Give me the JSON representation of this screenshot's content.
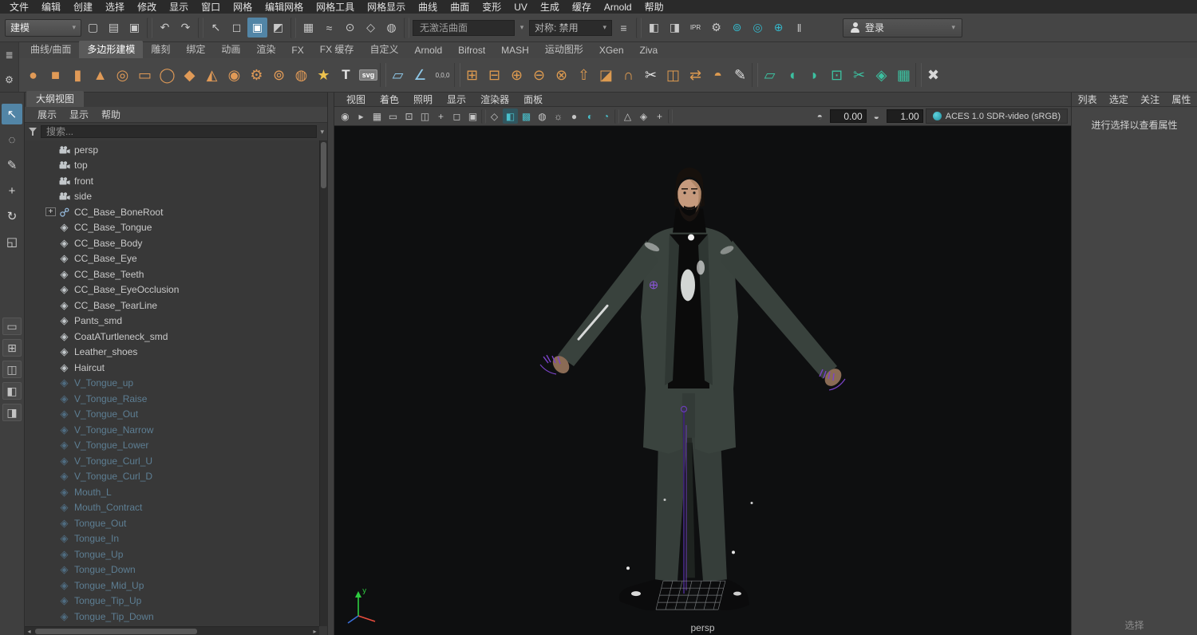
{
  "menubar": {
    "items": [
      "文件",
      "编辑",
      "创建",
      "选择",
      "修改",
      "显示",
      "窗口",
      "网格",
      "编辑网格",
      "网格工具",
      "网格显示",
      "曲线",
      "曲面",
      "变形",
      "UV",
      "生成",
      "缓存",
      "Arnold",
      "帮助"
    ]
  },
  "statusline": {
    "mode": "建模",
    "icons_left": [
      {
        "name": "new-scene-icon",
        "glyph": "▢"
      },
      {
        "name": "open-scene-icon",
        "glyph": "▤"
      },
      {
        "name": "save-scene-icon",
        "glyph": "▣"
      },
      {
        "name": "separator",
        "glyph": "",
        "variant": "sep"
      },
      {
        "name": "undo-icon",
        "glyph": "↶"
      },
      {
        "name": "redo-icon",
        "glyph": "↷"
      },
      {
        "name": "separator",
        "glyph": "",
        "variant": "sep"
      },
      {
        "name": "select-tool-icon",
        "glyph": "↖"
      },
      {
        "name": "select-hierarchy-icon",
        "glyph": "◻"
      },
      {
        "name": "select-object-mode-icon",
        "glyph": "▣",
        "variant": "active"
      },
      {
        "name": "select-component-mode-icon",
        "glyph": "◩"
      },
      {
        "name": "separator",
        "glyph": "",
        "variant": "sep"
      },
      {
        "name": "snap-to-grid-icon",
        "glyph": "▦"
      },
      {
        "name": "snap-to-curve-icon",
        "glyph": "≈"
      },
      {
        "name": "snap-to-point-icon",
        "glyph": "⊙"
      },
      {
        "name": "snap-to-plane-icon",
        "glyph": "◇"
      },
      {
        "name": "make-live-icon",
        "glyph": "◍"
      },
      {
        "name": "separator",
        "glyph": "",
        "variant": "sep"
      }
    ],
    "surface_field": "无激活曲面",
    "symmetry_field": "对称: 禁用",
    "icons_right": [
      {
        "name": "construction-history-icon",
        "glyph": "≡"
      },
      {
        "name": "separator",
        "glyph": "",
        "variant": "sep"
      },
      {
        "name": "render-frame-icon",
        "glyph": "◧"
      },
      {
        "name": "ipr-render-icon",
        "glyph": "◨"
      },
      {
        "name": "ipr-label-icon",
        "glyph": "IPR",
        "variant": "text"
      },
      {
        "name": "render-settings-icon",
        "glyph": "⚙"
      },
      {
        "name": "render-view-icon",
        "glyph": "⊚",
        "tint": "#35b5c8"
      },
      {
        "name": "light-editor-icon",
        "glyph": "◎",
        "tint": "#35b5c8"
      },
      {
        "name": "toggle-viewport-icon",
        "glyph": "⊕",
        "tint": "#35b5c8"
      },
      {
        "name": "pause-icon",
        "glyph": "‖"
      }
    ],
    "login_label": "登录"
  },
  "shelf": {
    "menu_icons": [
      {
        "name": "shelf-tab-list-icon",
        "glyph": "≣"
      },
      {
        "name": "shelf-gear-icon",
        "glyph": "⚙"
      }
    ],
    "tabs": [
      {
        "label": "曲线/曲面"
      },
      {
        "label": "多边形建模",
        "variant": "active"
      },
      {
        "label": "雕刻"
      },
      {
        "label": "绑定"
      },
      {
        "label": "动画"
      },
      {
        "label": "渲染"
      },
      {
        "label": "FX"
      },
      {
        "label": "FX 缓存"
      },
      {
        "label": "自定义"
      },
      {
        "label": "Arnold"
      },
      {
        "label": "Bifrost"
      },
      {
        "label": "MASH"
      },
      {
        "label": "运动图形"
      },
      {
        "label": "XGen"
      },
      {
        "label": "Ziva"
      }
    ],
    "icons": [
      {
        "name": "poly-sphere-icon",
        "glyph": "●",
        "tint": "#e09a57"
      },
      {
        "name": "poly-cube-icon",
        "glyph": "■",
        "tint": "#e09a57"
      },
      {
        "name": "poly-cylinder-icon",
        "glyph": "▮",
        "tint": "#e09a57"
      },
      {
        "name": "poly-cone-icon",
        "glyph": "▲",
        "tint": "#e09a57"
      },
      {
        "name": "poly-torus-icon",
        "glyph": "◎",
        "tint": "#e09a57"
      },
      {
        "name": "poly-plane-icon",
        "glyph": "▭",
        "tint": "#e09a57"
      },
      {
        "name": "poly-disc-icon",
        "glyph": "◯",
        "tint": "#e09a57"
      },
      {
        "name": "poly-platonic-icon",
        "glyph": "◆",
        "tint": "#e09a57"
      },
      {
        "name": "poly-pyramid-icon",
        "glyph": "◭",
        "tint": "#e09a57"
      },
      {
        "name": "poly-pipe-icon",
        "glyph": "◉",
        "tint": "#e09a57"
      },
      {
        "name": "poly-gear-icon",
        "glyph": "⚙",
        "tint": "#e09a57"
      },
      {
        "name": "poly-soccerball-icon",
        "glyph": "⊚",
        "tint": "#e09a57"
      },
      {
        "name": "poly-superellipse-icon",
        "glyph": "◍",
        "tint": "#e09a57"
      },
      {
        "name": "poly-star-icon",
        "glyph": "★",
        "tint": "#edc24e"
      },
      {
        "name": "poly-text-icon",
        "glyph": "T",
        "tint": "#e8e8e8",
        "variant": "boldtext"
      },
      {
        "name": "svg-tool-icon",
        "glyph": "svg",
        "variant": "badge"
      },
      {
        "name": "separator",
        "glyph": "",
        "variant": "sep"
      },
      {
        "name": "construction-plane-icon",
        "glyph": "▱",
        "tint": "#8fc8e8"
      },
      {
        "name": "angle-snap-icon",
        "glyph": "∠",
        "tint": "#8fc8e8"
      },
      {
        "name": "coordinates-icon",
        "glyph": "0,0,0",
        "tint": "#cfcfcf",
        "variant": "tinytext"
      },
      {
        "name": "separator",
        "glyph": "",
        "variant": "sep"
      },
      {
        "name": "combine-icon",
        "glyph": "⊞",
        "tint": "#dc9a50"
      },
      {
        "name": "separate-icon",
        "glyph": "⊟",
        "tint": "#dc9a50"
      },
      {
        "name": "boolean-union-icon",
        "glyph": "⊕",
        "tint": "#dc9a50"
      },
      {
        "name": "boolean-difference-icon",
        "glyph": "⊖",
        "tint": "#dc9a50"
      },
      {
        "name": "boolean-intersection-icon",
        "glyph": "⊗",
        "tint": "#dc9a50"
      },
      {
        "name": "extrude-icon",
        "glyph": "⇧",
        "tint": "#dc9a50"
      },
      {
        "name": "bevel-icon",
        "glyph": "◪",
        "tint": "#dc9a50"
      },
      {
        "name": "bridge-icon",
        "glyph": "∩",
        "tint": "#dc9a50"
      },
      {
        "name": "multi-cut-icon",
        "glyph": "✂",
        "tint": "#e0e0e0"
      },
      {
        "name": "insert-edge-loop-icon",
        "glyph": "◫",
        "tint": "#dc9a50"
      },
      {
        "name": "mirror-icon",
        "glyph": "⇄",
        "tint": "#dc9a50"
      },
      {
        "name": "smooth-icon",
        "glyph": "◓",
        "tint": "#dc9a50"
      },
      {
        "name": "quad-draw-icon",
        "glyph": "✎",
        "tint": "#e0e0e0"
      },
      {
        "name": "separator",
        "glyph": "",
        "variant": "sep"
      },
      {
        "name": "planar-uv-icon",
        "glyph": "▱",
        "tint": "#3cc0a0"
      },
      {
        "name": "cylindrical-uv-icon",
        "glyph": "◖",
        "tint": "#3cc0a0"
      },
      {
        "name": "spherical-uv-icon",
        "glyph": "◗",
        "tint": "#3cc0a0"
      },
      {
        "name": "automatic-uv-icon",
        "glyph": "⊡",
        "tint": "#3cc0a0"
      },
      {
        "name": "cut-uv-icon",
        "glyph": "✂",
        "tint": "#3cc0a0"
      },
      {
        "name": "unfold-uv-icon",
        "glyph": "◈",
        "tint": "#3cc0a0"
      },
      {
        "name": "layout-uv-icon",
        "glyph": "▦",
        "tint": "#3cc0a0"
      },
      {
        "name": "separator",
        "glyph": "",
        "variant": "sep"
      },
      {
        "name": "delete-component-icon",
        "glyph": "✖",
        "tint": "#d8d8d8"
      }
    ]
  },
  "toolbox": {
    "tools": [
      {
        "name": "select-tool-icon",
        "glyph": "↖",
        "variant": "active"
      },
      {
        "name": "lasso-tool-icon",
        "glyph": "◌"
      },
      {
        "name": "paint-select-tool-icon",
        "glyph": "✎"
      },
      {
        "name": "move-tool-icon",
        "glyph": "+"
      },
      {
        "name": "rotate-tool-icon",
        "glyph": "↻"
      },
      {
        "name": "scale-tool-icon",
        "glyph": "◱"
      }
    ],
    "layouts": [
      {
        "name": "layout-single-pane-icon",
        "glyph": "▭"
      },
      {
        "name": "layout-four-pane-icon",
        "glyph": "⊞"
      },
      {
        "name": "layout-two-pane-icon",
        "glyph": "◫"
      },
      {
        "name": "layout-outliner-pane-icon",
        "glyph": "◧"
      },
      {
        "name": "layout-split-pane-icon",
        "glyph": "◨"
      }
    ]
  },
  "outliner": {
    "title": "大纲视图",
    "menus": [
      "展示",
      "显示",
      "帮助"
    ],
    "search_placeholder": "搜索...",
    "items": [
      {
        "label": "persp",
        "type": "camera"
      },
      {
        "label": "top",
        "type": "camera"
      },
      {
        "label": "front",
        "type": "camera"
      },
      {
        "label": "side",
        "type": "camera"
      },
      {
        "label": "CC_Base_BoneRoot",
        "type": "joint",
        "expander": "+"
      },
      {
        "label": "CC_Base_Tongue",
        "type": "mesh"
      },
      {
        "label": "CC_Base_Body",
        "type": "mesh"
      },
      {
        "label": "CC_Base_Eye",
        "type": "mesh"
      },
      {
        "label": "CC_Base_Teeth",
        "type": "mesh"
      },
      {
        "label": "CC_Base_EyeOcclusion",
        "type": "mesh"
      },
      {
        "label": "CC_Base_TearLine",
        "type": "mesh"
      },
      {
        "label": "Pants_smd",
        "type": "mesh"
      },
      {
        "label": "CoatATurtleneck_smd",
        "type": "mesh"
      },
      {
        "label": "Leather_shoes",
        "type": "mesh"
      },
      {
        "label": "Haircut",
        "type": "mesh"
      },
      {
        "label": "V_Tongue_up",
        "type": "mesh",
        "variant": "dim"
      },
      {
        "label": "V_Tongue_Raise",
        "type": "mesh",
        "variant": "dim"
      },
      {
        "label": "V_Tongue_Out",
        "type": "mesh",
        "variant": "dim"
      },
      {
        "label": "V_Tongue_Narrow",
        "type": "mesh",
        "variant": "dim"
      },
      {
        "label": "V_Tongue_Lower",
        "type": "mesh",
        "variant": "dim"
      },
      {
        "label": "V_Tongue_Curl_U",
        "type": "mesh",
        "variant": "dim"
      },
      {
        "label": "V_Tongue_Curl_D",
        "type": "mesh",
        "variant": "dim"
      },
      {
        "label": "Mouth_L",
        "type": "mesh",
        "variant": "dim"
      },
      {
        "label": "Mouth_Contract",
        "type": "mesh",
        "variant": "dim"
      },
      {
        "label": "Tongue_Out",
        "type": "mesh",
        "variant": "dim"
      },
      {
        "label": "Tongue_In",
        "type": "mesh",
        "variant": "dim"
      },
      {
        "label": "Tongue_Up",
        "type": "mesh",
        "variant": "dim"
      },
      {
        "label": "Tongue_Down",
        "type": "mesh",
        "variant": "dim"
      },
      {
        "label": "Tongue_Mid_Up",
        "type": "mesh",
        "variant": "dim"
      },
      {
        "label": "Tongue_Tip_Up",
        "type": "mesh",
        "variant": "dim"
      },
      {
        "label": "Tongue_Tip_Down",
        "type": "mesh",
        "variant": "dim"
      }
    ]
  },
  "viewport": {
    "menus": [
      "视图",
      "着色",
      "照明",
      "显示",
      "渲染器",
      "面板"
    ],
    "toolbar_icons": [
      {
        "name": "camera-attributes-icon",
        "glyph": "◉"
      },
      {
        "name": "bookmark-icon",
        "glyph": "▸"
      },
      {
        "name": "grid-toggle-icon",
        "glyph": "▦"
      },
      {
        "name": "film-gate-icon",
        "glyph": "▭"
      },
      {
        "name": "resolution-gate-icon",
        "glyph": "⊡"
      },
      {
        "name": "gate-mask-icon",
        "glyph": "◫"
      },
      {
        "name": "field-chart-icon",
        "glyph": "+"
      },
      {
        "name": "safe-action-icon",
        "glyph": "◻"
      },
      {
        "name": "safe-title-icon",
        "glyph": "▣"
      },
      {
        "name": "separator",
        "glyph": "",
        "variant": "sep"
      },
      {
        "name": "wireframe-icon",
        "glyph": "◇"
      },
      {
        "name": "shaded-mode-icon",
        "glyph": "◧",
        "tint": "#49c0cc",
        "variant": "active"
      },
      {
        "name": "textured-mode-icon",
        "glyph": "▩",
        "tint": "#49c0cc"
      },
      {
        "name": "default-material-icon",
        "glyph": "◍"
      },
      {
        "name": "lighting-icon",
        "glyph": "☼"
      },
      {
        "name": "shadows-icon",
        "glyph": "●"
      },
      {
        "name": "ambient-occlusion-icon",
        "glyph": "◐",
        "tint": "#49c0cc"
      },
      {
        "name": "anti-aliasing-icon",
        "glyph": "◔",
        "tint": "#49c0cc"
      },
      {
        "name": "separator",
        "glyph": "",
        "variant": "sep"
      },
      {
        "name": "isolate-select-icon",
        "glyph": "△"
      },
      {
        "name": "xray-icon",
        "glyph": "◈"
      },
      {
        "name": "joint-xray-icon",
        "glyph": "+"
      },
      {
        "name": "separator",
        "glyph": "",
        "variant": "sep"
      }
    ],
    "exposure_icon": "◓",
    "exposure": "0.00",
    "gamma_icon": "◒",
    "gamma": "1.00",
    "colorspace": "ACES 1.0 SDR-video (sRGB)",
    "camera_label": "persp"
  },
  "right_panel": {
    "menus": [
      "列表",
      "选定",
      "关注",
      "属性"
    ],
    "empty_message": "进行选择以查看属性",
    "bottom_label": "选择"
  }
}
